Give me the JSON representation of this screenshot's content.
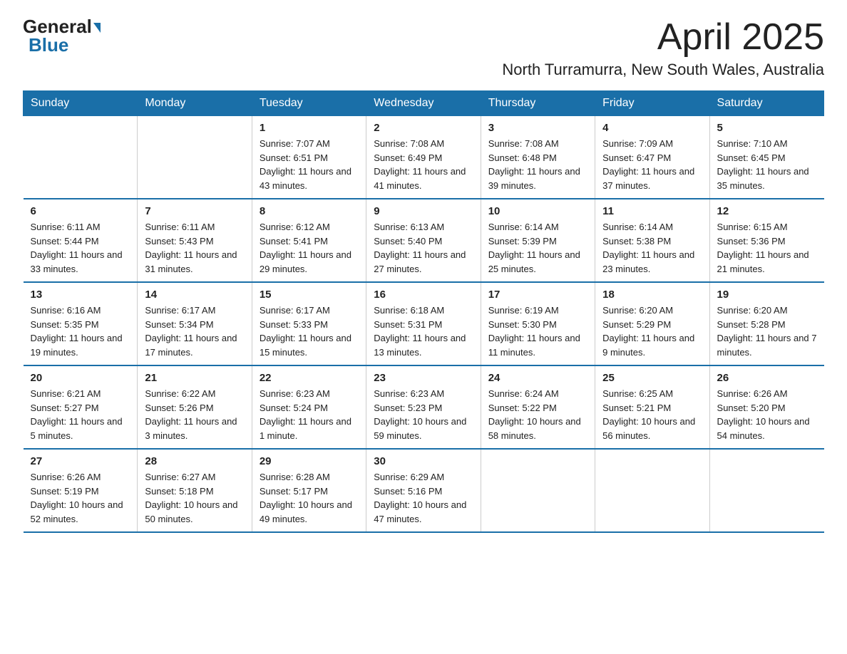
{
  "header": {
    "logo_general": "General",
    "logo_blue": "Blue",
    "title_month": "April 2025",
    "title_location": "North Turramurra, New South Wales, Australia"
  },
  "weekdays": [
    "Sunday",
    "Monday",
    "Tuesday",
    "Wednesday",
    "Thursday",
    "Friday",
    "Saturday"
  ],
  "weeks": [
    [
      {
        "day": "",
        "sunrise": "",
        "sunset": "",
        "daylight": ""
      },
      {
        "day": "",
        "sunrise": "",
        "sunset": "",
        "daylight": ""
      },
      {
        "day": "1",
        "sunrise": "Sunrise: 7:07 AM",
        "sunset": "Sunset: 6:51 PM",
        "daylight": "Daylight: 11 hours and 43 minutes."
      },
      {
        "day": "2",
        "sunrise": "Sunrise: 7:08 AM",
        "sunset": "Sunset: 6:49 PM",
        "daylight": "Daylight: 11 hours and 41 minutes."
      },
      {
        "day": "3",
        "sunrise": "Sunrise: 7:08 AM",
        "sunset": "Sunset: 6:48 PM",
        "daylight": "Daylight: 11 hours and 39 minutes."
      },
      {
        "day": "4",
        "sunrise": "Sunrise: 7:09 AM",
        "sunset": "Sunset: 6:47 PM",
        "daylight": "Daylight: 11 hours and 37 minutes."
      },
      {
        "day": "5",
        "sunrise": "Sunrise: 7:10 AM",
        "sunset": "Sunset: 6:45 PM",
        "daylight": "Daylight: 11 hours and 35 minutes."
      }
    ],
    [
      {
        "day": "6",
        "sunrise": "Sunrise: 6:11 AM",
        "sunset": "Sunset: 5:44 PM",
        "daylight": "Daylight: 11 hours and 33 minutes."
      },
      {
        "day": "7",
        "sunrise": "Sunrise: 6:11 AM",
        "sunset": "Sunset: 5:43 PM",
        "daylight": "Daylight: 11 hours and 31 minutes."
      },
      {
        "day": "8",
        "sunrise": "Sunrise: 6:12 AM",
        "sunset": "Sunset: 5:41 PM",
        "daylight": "Daylight: 11 hours and 29 minutes."
      },
      {
        "day": "9",
        "sunrise": "Sunrise: 6:13 AM",
        "sunset": "Sunset: 5:40 PM",
        "daylight": "Daylight: 11 hours and 27 minutes."
      },
      {
        "day": "10",
        "sunrise": "Sunrise: 6:14 AM",
        "sunset": "Sunset: 5:39 PM",
        "daylight": "Daylight: 11 hours and 25 minutes."
      },
      {
        "day": "11",
        "sunrise": "Sunrise: 6:14 AM",
        "sunset": "Sunset: 5:38 PM",
        "daylight": "Daylight: 11 hours and 23 minutes."
      },
      {
        "day": "12",
        "sunrise": "Sunrise: 6:15 AM",
        "sunset": "Sunset: 5:36 PM",
        "daylight": "Daylight: 11 hours and 21 minutes."
      }
    ],
    [
      {
        "day": "13",
        "sunrise": "Sunrise: 6:16 AM",
        "sunset": "Sunset: 5:35 PM",
        "daylight": "Daylight: 11 hours and 19 minutes."
      },
      {
        "day": "14",
        "sunrise": "Sunrise: 6:17 AM",
        "sunset": "Sunset: 5:34 PM",
        "daylight": "Daylight: 11 hours and 17 minutes."
      },
      {
        "day": "15",
        "sunrise": "Sunrise: 6:17 AM",
        "sunset": "Sunset: 5:33 PM",
        "daylight": "Daylight: 11 hours and 15 minutes."
      },
      {
        "day": "16",
        "sunrise": "Sunrise: 6:18 AM",
        "sunset": "Sunset: 5:31 PM",
        "daylight": "Daylight: 11 hours and 13 minutes."
      },
      {
        "day": "17",
        "sunrise": "Sunrise: 6:19 AM",
        "sunset": "Sunset: 5:30 PM",
        "daylight": "Daylight: 11 hours and 11 minutes."
      },
      {
        "day": "18",
        "sunrise": "Sunrise: 6:20 AM",
        "sunset": "Sunset: 5:29 PM",
        "daylight": "Daylight: 11 hours and 9 minutes."
      },
      {
        "day": "19",
        "sunrise": "Sunrise: 6:20 AM",
        "sunset": "Sunset: 5:28 PM",
        "daylight": "Daylight: 11 hours and 7 minutes."
      }
    ],
    [
      {
        "day": "20",
        "sunrise": "Sunrise: 6:21 AM",
        "sunset": "Sunset: 5:27 PM",
        "daylight": "Daylight: 11 hours and 5 minutes."
      },
      {
        "day": "21",
        "sunrise": "Sunrise: 6:22 AM",
        "sunset": "Sunset: 5:26 PM",
        "daylight": "Daylight: 11 hours and 3 minutes."
      },
      {
        "day": "22",
        "sunrise": "Sunrise: 6:23 AM",
        "sunset": "Sunset: 5:24 PM",
        "daylight": "Daylight: 11 hours and 1 minute."
      },
      {
        "day": "23",
        "sunrise": "Sunrise: 6:23 AM",
        "sunset": "Sunset: 5:23 PM",
        "daylight": "Daylight: 10 hours and 59 minutes."
      },
      {
        "day": "24",
        "sunrise": "Sunrise: 6:24 AM",
        "sunset": "Sunset: 5:22 PM",
        "daylight": "Daylight: 10 hours and 58 minutes."
      },
      {
        "day": "25",
        "sunrise": "Sunrise: 6:25 AM",
        "sunset": "Sunset: 5:21 PM",
        "daylight": "Daylight: 10 hours and 56 minutes."
      },
      {
        "day": "26",
        "sunrise": "Sunrise: 6:26 AM",
        "sunset": "Sunset: 5:20 PM",
        "daylight": "Daylight: 10 hours and 54 minutes."
      }
    ],
    [
      {
        "day": "27",
        "sunrise": "Sunrise: 6:26 AM",
        "sunset": "Sunset: 5:19 PM",
        "daylight": "Daylight: 10 hours and 52 minutes."
      },
      {
        "day": "28",
        "sunrise": "Sunrise: 6:27 AM",
        "sunset": "Sunset: 5:18 PM",
        "daylight": "Daylight: 10 hours and 50 minutes."
      },
      {
        "day": "29",
        "sunrise": "Sunrise: 6:28 AM",
        "sunset": "Sunset: 5:17 PM",
        "daylight": "Daylight: 10 hours and 49 minutes."
      },
      {
        "day": "30",
        "sunrise": "Sunrise: 6:29 AM",
        "sunset": "Sunset: 5:16 PM",
        "daylight": "Daylight: 10 hours and 47 minutes."
      },
      {
        "day": "",
        "sunrise": "",
        "sunset": "",
        "daylight": ""
      },
      {
        "day": "",
        "sunrise": "",
        "sunset": "",
        "daylight": ""
      },
      {
        "day": "",
        "sunrise": "",
        "sunset": "",
        "daylight": ""
      }
    ]
  ]
}
